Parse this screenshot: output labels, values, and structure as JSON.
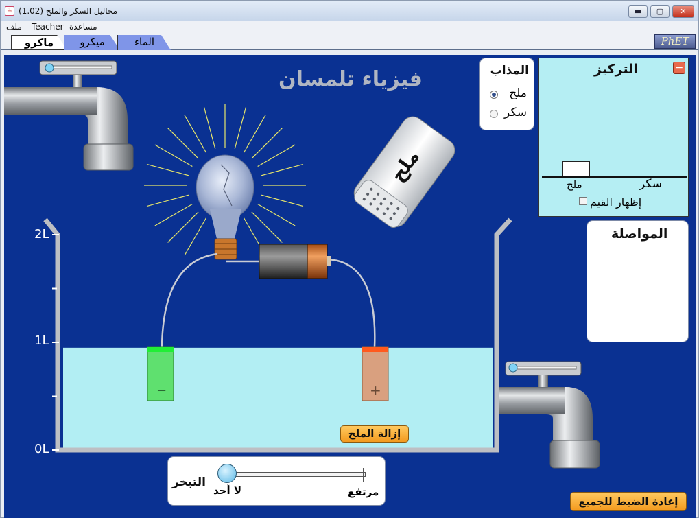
{
  "window": {
    "title": "(محاليل السكر والملح (1.02",
    "title_icon": "java-cup-icon",
    "controls": {
      "minimize": "▬",
      "maximize": "▢",
      "close": "✕"
    }
  },
  "menu": {
    "items": [
      "ملف",
      "Teacher",
      "مساعدة"
    ]
  },
  "tabs": [
    {
      "label": "ماكرو",
      "active": true
    },
    {
      "label": "ميكرو",
      "active": false
    },
    {
      "label": "الماء",
      "active": false
    }
  ],
  "logo": {
    "text": "PhET"
  },
  "sim": {
    "heading": "فيزياء تلمسان",
    "background_color": "#0a3192",
    "solute_panel": {
      "title": "المذاب",
      "options": [
        "ملح",
        "سكر"
      ],
      "selected": "ملح"
    },
    "shaker_label": "ملح",
    "concentration_panel": {
      "title": "التركيز",
      "categories": [
        "ملح",
        "سكر"
      ],
      "show_values_label": "إظهار القيم",
      "show_values_checked": false,
      "collapse_icon": "minus-icon"
    },
    "conductivity_panel": {
      "title": "المواصلة"
    },
    "beaker": {
      "tick_labels": [
        "2L",
        "1L",
        "0L"
      ],
      "fill_level_liters": 0.95,
      "capacity_liters": 2
    },
    "electrodes": {
      "negative_symbol": "−",
      "positive_symbol": "+"
    },
    "remove_salt_button": "إزالة الملح",
    "evaporation": {
      "title": "التبخر",
      "min_label": "لا أحد",
      "max_label": "مرتفع",
      "level": 0
    },
    "reset_all_button": "إعادة الضبط للجميع"
  }
}
